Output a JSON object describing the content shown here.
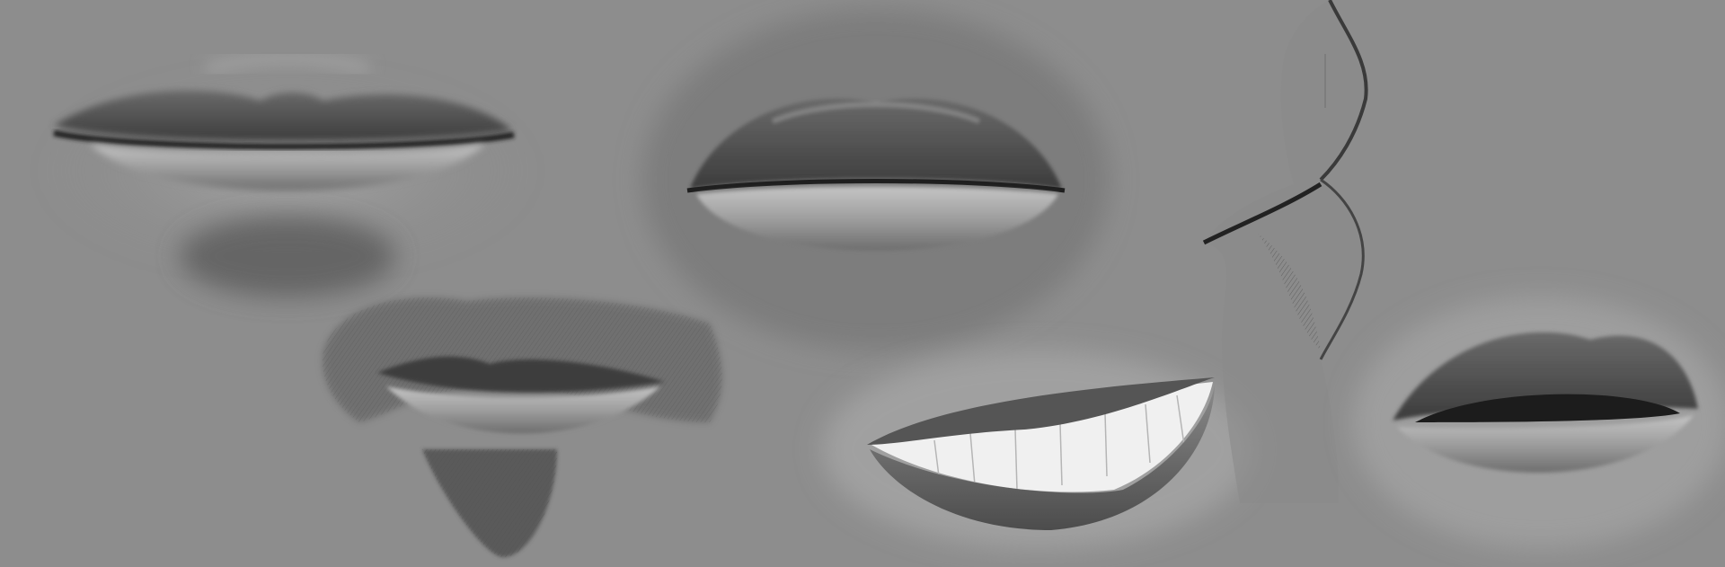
{
  "image": {
    "description_type": "grayscale digital sketch study sheet",
    "colors": {
      "background": "#8d8d8d",
      "lip_dark": "#3a3a3a",
      "lip_mid": "#6f6f6f",
      "lip_light": "#b5b5b5",
      "skin_light": "#a3a3a3",
      "teeth": "#efefef",
      "hair": "#4a4a4a"
    },
    "studies": [
      {
        "id": "closed-lips-soft",
        "icon": "closed-mouth-sketch"
      },
      {
        "id": "lips-with-goatee",
        "icon": "mustache-mouth-sketch"
      },
      {
        "id": "full-lips-front",
        "icon": "full-lips-sketch"
      },
      {
        "id": "smile-teeth",
        "icon": "smile-sketch"
      },
      {
        "id": "lips-profile",
        "icon": "profile-lips-sketch"
      },
      {
        "id": "parted-lips",
        "icon": "parted-lips-sketch"
      }
    ]
  }
}
